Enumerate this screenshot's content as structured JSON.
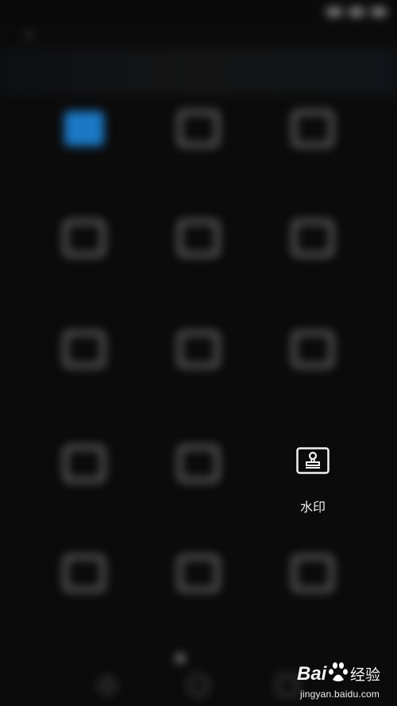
{
  "colors": {
    "background": "#0b0b0b",
    "accent": "#1b78c5",
    "foreground": "#f0f0f0"
  },
  "topbar": {
    "back_icon": "back-arrow-icon",
    "title": "",
    "action_label": ""
  },
  "tools": [
    {
      "name": "tool-1",
      "icon": "accent-tile-icon",
      "label": "",
      "accent": true
    },
    {
      "name": "tool-2",
      "icon": "house-icon",
      "label": ""
    },
    {
      "name": "tool-3",
      "icon": "tag-icon",
      "label": ""
    },
    {
      "name": "tool-4",
      "icon": "cloud-folder-icon",
      "label": ""
    },
    {
      "name": "tool-5",
      "icon": "arrows-icon",
      "label": ""
    },
    {
      "name": "tool-6",
      "icon": "document-icon",
      "label": ""
    },
    {
      "name": "tool-7",
      "icon": "panel-icon",
      "label": ""
    },
    {
      "name": "tool-8",
      "icon": "shuffle-icon",
      "label": ""
    },
    {
      "name": "tool-9",
      "icon": "box-icon",
      "label": ""
    },
    {
      "name": "tool-10",
      "icon": "camera-icon",
      "label": ""
    },
    {
      "name": "tool-11",
      "icon": "cross-icon",
      "label": ""
    },
    {
      "name": "tool-12",
      "icon": "file-icon",
      "label": ""
    },
    {
      "name": "tool-13",
      "icon": "scissors-icon",
      "label": ""
    },
    {
      "name": "tool-14",
      "icon": "fire-icon",
      "label": ""
    }
  ],
  "watermark_tool": {
    "icon": "stamp-icon",
    "label": "水印"
  },
  "brand": {
    "logo_text": "Bai",
    "logo_suffix": "经验",
    "url": "jingyan.baidu.com"
  }
}
